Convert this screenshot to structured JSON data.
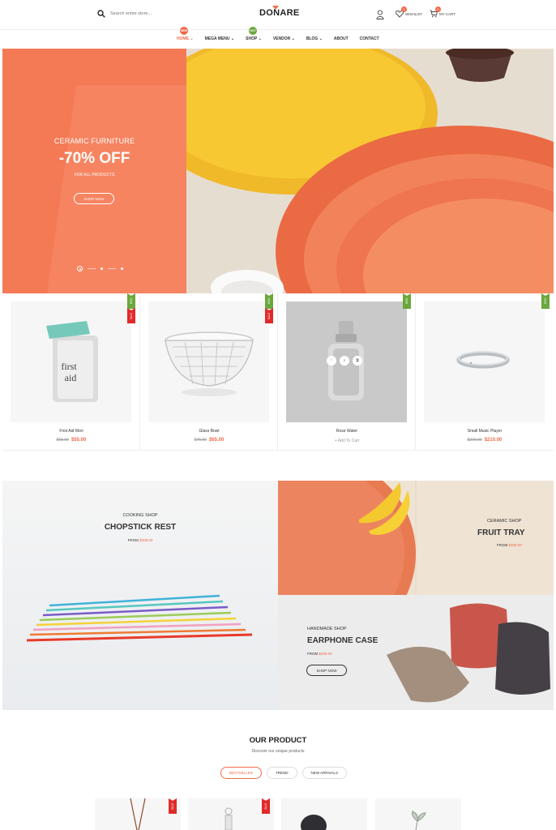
{
  "header": {
    "search_placeholder": "Search entire store...",
    "logo": "DONARE",
    "wishlist_label": "WISHLIST",
    "wishlist_count": "0",
    "cart_label": "MY CART",
    "cart_count": "0"
  },
  "nav": {
    "items": [
      {
        "label": "HOME",
        "tag": "NEW"
      },
      {
        "label": "MEGA MENU"
      },
      {
        "label": "SHOP",
        "tag": "HOT"
      },
      {
        "label": "VENDOR"
      },
      {
        "label": "BLOG"
      },
      {
        "label": "ABOUT"
      },
      {
        "label": "CONTACT"
      }
    ]
  },
  "hero": {
    "subtitle": "CERAMIC FURNITURE",
    "title": "-70% OFF",
    "small": "FOR ALL PRODUCTS",
    "button": "SHOP NOW"
  },
  "products": [
    {
      "name": "First Aid Mori",
      "old_price": "$65.00",
      "price": "$55.00",
      "labels": [
        "NEW",
        "SALE"
      ]
    },
    {
      "name": "Glass Bowl",
      "old_price": "$75.00",
      "price": "$65.00",
      "labels": [
        "NEW",
        "SALE"
      ]
    },
    {
      "name": "Rose Water",
      "add_to_cart": "+ Add To Cart",
      "labels": [
        "NEW"
      ]
    },
    {
      "name": "Small Music Player",
      "old_price": "$220.00",
      "price": "$210.00",
      "labels": [
        "NEW"
      ]
    }
  ],
  "banners": {
    "chopstick": {
      "category": "COOKING SHOP",
      "title": "CHOPSTICK REST",
      "from": "FROM ",
      "price": "$308.00"
    },
    "fruit": {
      "category": "CERAMIC SHOP",
      "title": "FRUIT TRAY",
      "from": "FROM ",
      "price": "$308.00"
    },
    "earphone": {
      "category": "HANDMADE SHOP",
      "title": "EARPHONE CASE",
      "from": "FROM ",
      "price": "$308.00",
      "button": "SHOP NOW"
    }
  },
  "our_product": {
    "title": "OUR PRODUCT",
    "subtitle": "Discover our unique products",
    "tabs": [
      "BESTSELLER",
      "TREND",
      "NEW ARRIVALS"
    ],
    "mini_labels": [
      "SALE",
      "SALE"
    ]
  },
  "colors": {
    "accent": "#f26b4b",
    "new": "#6aa83b",
    "sale": "#e02a2a",
    "hero": "#f47a55"
  }
}
